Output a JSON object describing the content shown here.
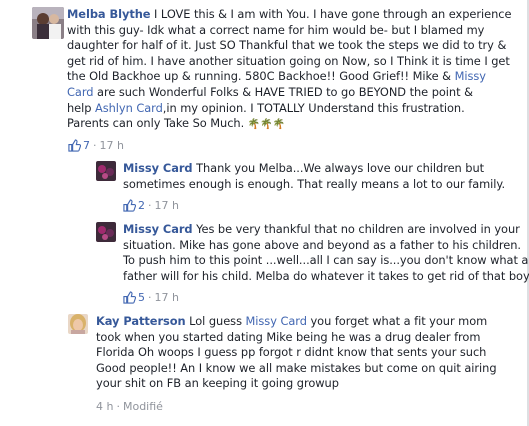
{
  "comments": [
    {
      "author": "Melba Blythe",
      "lines": [
        [
          {
            "t": "I LOVE this & I am with You. I have gone through an experience"
          }
        ],
        [
          {
            "t": "with this guy- Idk what a correct name for him would be- but I blamed my"
          }
        ],
        [
          {
            "t": "daughter for half of it. Just SO Thankful that we took the steps we did to try &"
          }
        ],
        [
          {
            "t": "get rid of him. I have another situation going on Now, so I Think it is time I get"
          }
        ],
        [
          {
            "t": "the Old Backhoe up & running. 580C Backhoe!! Good Grief!! Mike & "
          },
          {
            "t": "Missy",
            "m": true
          }
        ],
        [
          {
            "t": "Card",
            "m": true
          },
          {
            "t": " are such Wonderful Folks & HAVE TRIED to go BEYOND the point &"
          }
        ],
        [
          {
            "t": "help "
          },
          {
            "t": "Ashlyn Card",
            "m": true
          },
          {
            "t": ",in my opinion. I TOTALLY Understand this frustration."
          }
        ],
        [
          {
            "t": "Parents can only Take So Much. "
          },
          {
            "t": "🌴🌴🌴",
            "e": true
          }
        ]
      ],
      "likes": "7",
      "time": "17 h"
    },
    {
      "author": "Missy Card",
      "lines": [
        [
          {
            "t": "Thank you Melba...We always love our children but"
          }
        ],
        [
          {
            "t": "sometimes enough is enough. That really means a lot to our family."
          }
        ]
      ],
      "likes": "2",
      "time": "17 h"
    },
    {
      "author": "Missy Card",
      "lines": [
        [
          {
            "t": "Yes be very thankful that no children are involved in your"
          }
        ],
        [
          {
            "t": "situation. Mike has gone above and beyond as a father to his children."
          }
        ],
        [
          {
            "t": "To push him to this point ...well...all I can say is...you don't know what a"
          }
        ],
        [
          {
            "t": "father will for his child. Melba do whatever it takes to get rid of that boy."
          }
        ]
      ],
      "likes": "5",
      "time": "17 h"
    },
    {
      "author": "Kay Patterson",
      "lines": [
        [
          {
            "t": "Lol guess "
          },
          {
            "t": "Missy Card",
            "m": true
          },
          {
            "t": " you forget what a fit your mom"
          }
        ],
        [
          {
            "t": "took when you started dating Mike being he was a drug dealer from"
          }
        ],
        [
          {
            "t": "Florida Oh woops I guess pp forgot r didnt know that sents your such"
          }
        ],
        [
          {
            "t": "Good people!! An I know we all make mistakes but come on quit airing"
          }
        ],
        [
          {
            "t": "your shit on FB an keeping it going growup"
          }
        ]
      ],
      "time": "4 h",
      "edited": "Modifié"
    }
  ],
  "separator": "·",
  "colors": {
    "link": "#365899",
    "meta": "#90949c",
    "text": "#1d2129"
  }
}
